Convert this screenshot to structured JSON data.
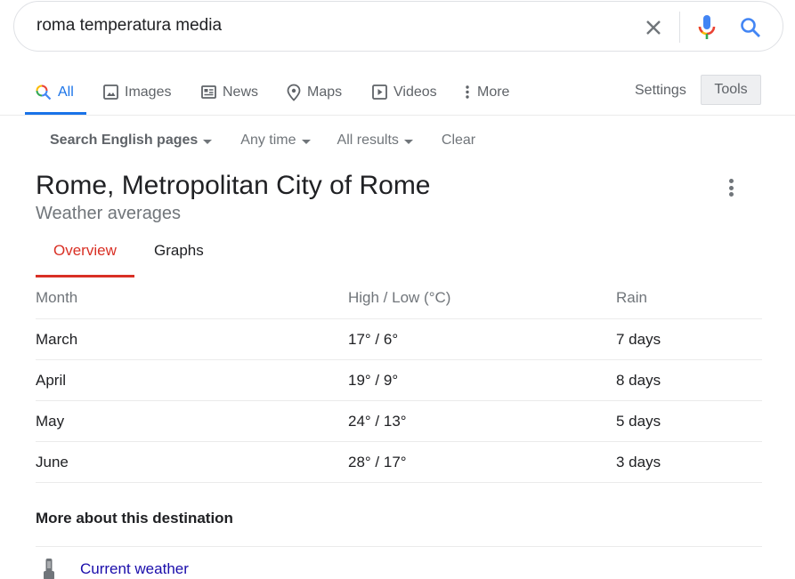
{
  "search": {
    "query": "roma temperatura media",
    "icons": {
      "clear": "close-icon",
      "voice": "mic-icon",
      "submit": "search-icon"
    },
    "colors": {
      "blue": "#4285f4",
      "red": "#ea4335",
      "yellow": "#fbbc05",
      "green": "#34a853"
    }
  },
  "tabs": {
    "items": [
      {
        "label": "All",
        "icon": "search-icon",
        "active": true
      },
      {
        "label": "Images",
        "icon": "image-icon"
      },
      {
        "label": "News",
        "icon": "news-icon"
      },
      {
        "label": "Maps",
        "icon": "map-pin-icon"
      },
      {
        "label": "Videos",
        "icon": "play-icon"
      },
      {
        "label": "More",
        "icon": "more-vert-icon"
      }
    ],
    "settings_label": "Settings",
    "tools_label": "Tools",
    "accent": "#1a73e8"
  },
  "filters": [
    {
      "label": "Search English pages",
      "dropdown": true
    },
    {
      "label": "Any time",
      "dropdown": true
    },
    {
      "label": "All results",
      "dropdown": true
    },
    {
      "label": "Clear",
      "dropdown": false
    }
  ],
  "card": {
    "title": "Rome, Metropolitan City of Rome",
    "subtitle": "Weather averages",
    "tabs": [
      {
        "label": "Overview",
        "active": true
      },
      {
        "label": "Graphs"
      }
    ],
    "accent": "#d93025",
    "table": {
      "headers": [
        "Month",
        "High / Low (°C)",
        "Rain"
      ],
      "rows": [
        [
          "March",
          "17° / 6°",
          "7 days"
        ],
        [
          "April",
          "19° / 9°",
          "8 days"
        ],
        [
          "May",
          "24° / 13°",
          "5 days"
        ],
        [
          "June",
          "28° / 17°",
          "3 days"
        ]
      ]
    },
    "more_title": "More about this destination",
    "links": [
      {
        "label": "Current weather",
        "icon": "thermometer-icon"
      }
    ]
  }
}
